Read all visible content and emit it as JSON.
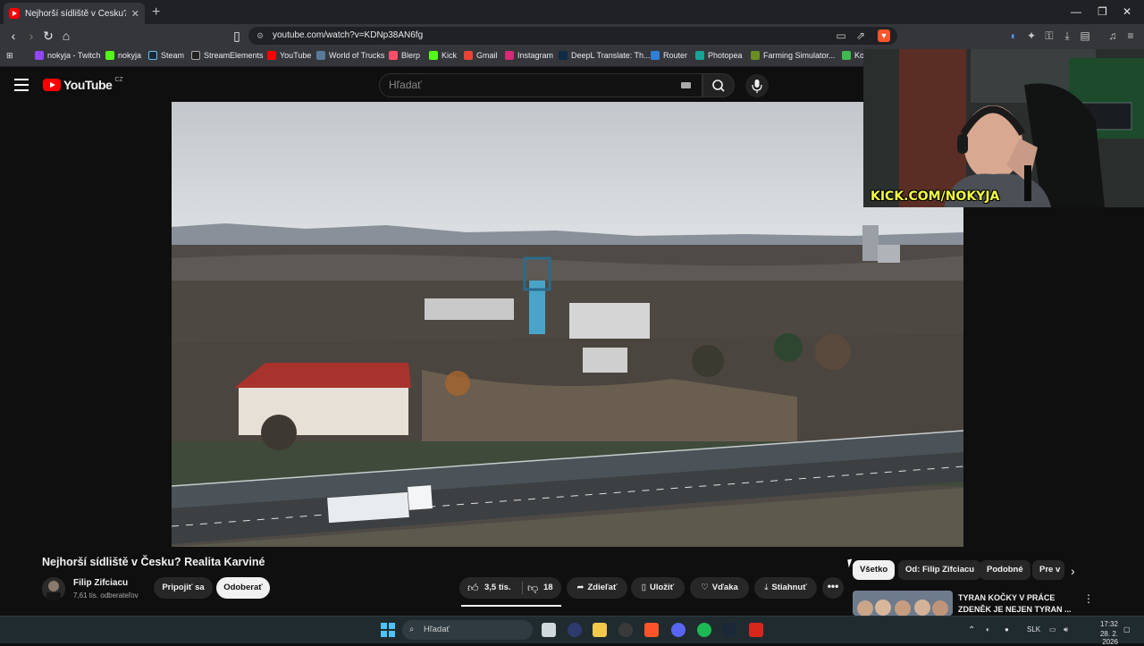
{
  "browser": {
    "tab_title": "Nejhorší sídliště v Česku? Re",
    "tab_close": "✕",
    "new_tab": "+",
    "url": "youtube.com/watch?v=KDNp38AN6fg",
    "window_controls": [
      "—",
      "❐",
      "✕"
    ]
  },
  "bookmarks": [
    {
      "label": "nokyja - Twitch",
      "color": "#9146ff"
    },
    {
      "label": "nokyja",
      "color": "#53fc18"
    },
    {
      "label": "Steam",
      "color": "#1b2838"
    },
    {
      "label": "StreamElements",
      "color": "#222222"
    },
    {
      "label": "YouTube",
      "color": "#ff0000"
    },
    {
      "label": "World of Trucks",
      "color": "#5a7a9a"
    },
    {
      "label": "Blerp",
      "color": "#ff4f6a"
    },
    {
      "label": "Kick",
      "color": "#53fc18"
    },
    {
      "label": "Gmail",
      "color": "#ea4335"
    },
    {
      "label": "Instagram",
      "color": "#d62976"
    },
    {
      "label": "DeepL Translate: Th...",
      "color": "#0f2b46"
    },
    {
      "label": "Router",
      "color": "#2f7fd8"
    },
    {
      "label": "Photopea",
      "color": "#18a497"
    },
    {
      "label": "Farming Simulator...",
      "color": "#6b8e23"
    },
    {
      "label": "Ko",
      "color": "#3fb950"
    }
  ],
  "youtube": {
    "logo_text": "YouTube",
    "logo_region": "CZ",
    "search_placeholder": "Hľadať",
    "video_title": "Nejhorší sídliště v Česku? Realita Karviné",
    "channel_name": "Filip Zifciacu",
    "subscribers": "7,61 tis. odberateľov",
    "join_label": "Pripojiť sa",
    "subscribe_label": "Odoberať",
    "likes": "3,5 tis.",
    "dislikes": "18",
    "share_label": "Zdieľať",
    "save_label": "Uložiť",
    "thanks_label": "Vďaka",
    "download_label": "Stiahnuť",
    "more_label": "•••",
    "chips": [
      "Všetko",
      "Od: Filip Zifciacu",
      "Podobné",
      "Pre v"
    ],
    "rec_title": "TYRAN KOČKY V PRÁCE ZDENĚK JE NEJEN TYRAN ..."
  },
  "webcam": {
    "overlay_text": "KICK.COM/NOKYJA"
  },
  "taskbar": {
    "search_placeholder": "Hľadať",
    "language": "SLK",
    "time": "17:32",
    "date": "28. 2. 2026"
  }
}
